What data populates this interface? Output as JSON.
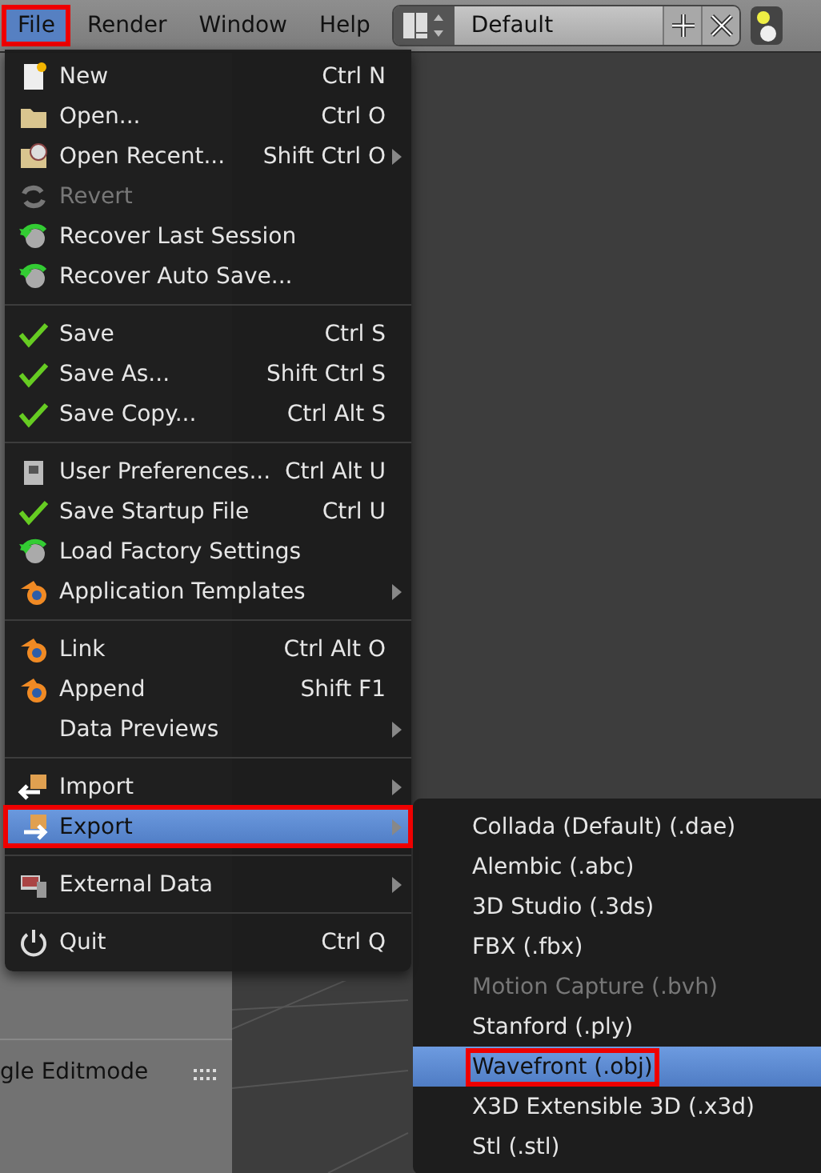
{
  "menubar": [
    {
      "label": "File",
      "selected": true,
      "marked": true
    },
    {
      "label": "Render",
      "selected": false,
      "marked": false
    },
    {
      "label": "Window",
      "selected": false,
      "marked": false
    },
    {
      "label": "Help",
      "selected": false,
      "marked": false
    }
  ],
  "layout_selector": {
    "value": "Default"
  },
  "tool_panel": {
    "label": "gle Editmode"
  },
  "file_menu": {
    "groups": [
      [
        {
          "label": "New",
          "shortcut": "Ctrl N",
          "submenu": false,
          "disabled": false,
          "selected": false,
          "marked": false
        },
        {
          "label": "Open...",
          "shortcut": "Ctrl O",
          "submenu": false,
          "disabled": false,
          "selected": false,
          "marked": false
        },
        {
          "label": "Open Recent...",
          "shortcut": "Shift Ctrl O",
          "submenu": true,
          "disabled": false,
          "selected": false,
          "marked": false
        },
        {
          "label": "Revert",
          "submenu": false,
          "disabled": true,
          "selected": false,
          "marked": false
        },
        {
          "label": "Recover Last Session",
          "submenu": false,
          "disabled": false,
          "selected": false,
          "marked": false
        },
        {
          "label": "Recover Auto Save...",
          "submenu": false,
          "disabled": false,
          "selected": false,
          "marked": false
        }
      ],
      [
        {
          "label": "Save",
          "shortcut": "Ctrl S",
          "submenu": false,
          "disabled": false,
          "selected": false,
          "marked": false
        },
        {
          "label": "Save As...",
          "shortcut": "Shift Ctrl S",
          "submenu": false,
          "disabled": false,
          "selected": false,
          "marked": false
        },
        {
          "label": "Save Copy...",
          "shortcut": "Ctrl Alt S",
          "submenu": false,
          "disabled": false,
          "selected": false,
          "marked": false
        }
      ],
      [
        {
          "label": "User Preferences...",
          "shortcut": "Ctrl Alt U",
          "submenu": false,
          "disabled": false,
          "selected": false,
          "marked": false
        },
        {
          "label": "Save Startup File",
          "shortcut": "Ctrl U",
          "submenu": false,
          "disabled": false,
          "selected": false,
          "marked": false
        },
        {
          "label": "Load Factory Settings",
          "submenu": false,
          "disabled": false,
          "selected": false,
          "marked": false
        },
        {
          "label": "Application Templates",
          "submenu": true,
          "disabled": false,
          "selected": false,
          "marked": false
        }
      ],
      [
        {
          "label": "Link",
          "shortcut": "Ctrl Alt O",
          "submenu": false,
          "disabled": false,
          "selected": false,
          "marked": false
        },
        {
          "label": "Append",
          "shortcut": "Shift F1",
          "submenu": false,
          "disabled": false,
          "selected": false,
          "marked": false
        },
        {
          "label": "Data Previews",
          "submenu": true,
          "disabled": false,
          "selected": false,
          "marked": false
        }
      ],
      [
        {
          "label": "Import",
          "submenu": true,
          "disabled": false,
          "selected": false,
          "marked": false
        },
        {
          "label": "Export",
          "submenu": true,
          "disabled": false,
          "selected": true,
          "marked": true
        }
      ],
      [
        {
          "label": "External Data",
          "submenu": true,
          "disabled": false,
          "selected": false,
          "marked": false
        }
      ],
      [
        {
          "label": "Quit",
          "shortcut": "Ctrl Q",
          "submenu": false,
          "disabled": false,
          "selected": false,
          "marked": false
        }
      ]
    ]
  },
  "export_menu": {
    "items": [
      {
        "label": "Collada (Default) (.dae)",
        "disabled": false,
        "selected": false,
        "marked": false
      },
      {
        "label": "Alembic (.abc)",
        "disabled": false,
        "selected": false,
        "marked": false
      },
      {
        "label": "3D Studio (.3ds)",
        "disabled": false,
        "selected": false,
        "marked": false
      },
      {
        "label": "FBX (.fbx)",
        "disabled": false,
        "selected": false,
        "marked": false
      },
      {
        "label": "Motion Capture (.bvh)",
        "disabled": true,
        "selected": false,
        "marked": false
      },
      {
        "label": "Stanford (.ply)",
        "disabled": false,
        "selected": false,
        "marked": false
      },
      {
        "label": "Wavefront (.obj)",
        "disabled": false,
        "selected": true,
        "marked": true
      },
      {
        "label": "X3D Extensible 3D (.x3d)",
        "disabled": false,
        "selected": false,
        "marked": false
      },
      {
        "label": "Stl (.stl)",
        "disabled": false,
        "selected": false,
        "marked": false
      }
    ]
  }
}
